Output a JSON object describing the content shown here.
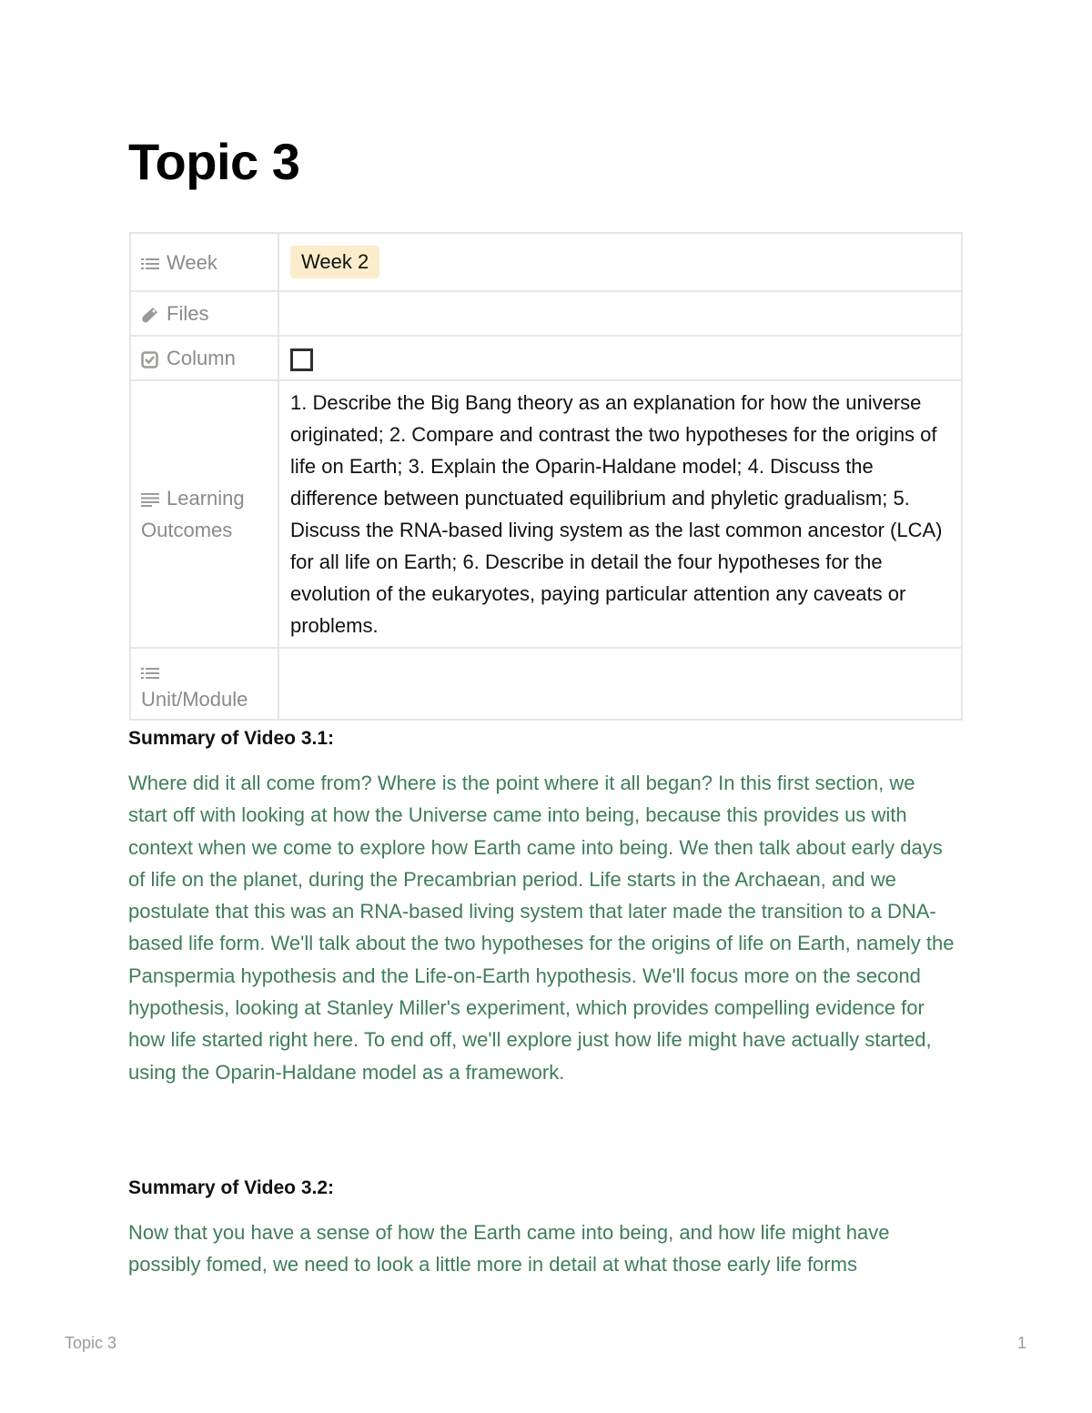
{
  "page": {
    "title": "Topic 3"
  },
  "properties": [
    {
      "icon": "list-icon",
      "name": "Week",
      "value": "Week 2",
      "type": "select",
      "badge_color": "#fbeccb"
    },
    {
      "icon": "paperclip-icon",
      "name": "Files",
      "value": "",
      "type": "files"
    },
    {
      "icon": "checkbox-icon",
      "name": "Column",
      "value": false,
      "type": "checkbox"
    },
    {
      "icon": "text-lines-icon",
      "name": "Learning Outcomes",
      "value": "1. Describe the Big Bang theory as an explanation for how the universe originated; 2. Compare and contrast the two hypotheses for the origins of life on Earth; 3. Explain the Oparin-Haldane model; 4. Discuss the difference between punctuated equilibrium and phyletic gradualism; 5. Discuss the RNA-based living system as the last common ancestor (LCA) for all life on Earth; 6. Describe in detail the four hypotheses for the evolution of the eukaryotes, paying particular attention any caveats or problems.",
      "type": "text"
    },
    {
      "icon": "list-icon",
      "name": "Unit/Module",
      "value": "",
      "type": "select"
    }
  ],
  "sections": [
    {
      "heading": "Summary of Video 3.1:",
      "body": "Where did it all come from? Where is the point where it all began? In this first section, we start off with looking at how the Universe came into being, because this provides us with context when we come to explore how Earth came into being. We then talk about early days of life on the planet, during the Precambrian period. Life starts in the Archaean, and we postulate that this was an RNA-based living system that later made the transition to a DNA-based life form. We'll talk about the two hypotheses for the origins of life on Earth, namely the Panspermia hypothesis and the Life-on-Earth hypothesis. We'll focus more on the second hypothesis, looking at Stanley Miller's experiment, which provides compelling evidence for how life started right here. To end off, we'll explore just how life might have actually started, using the Oparin-Haldane model as a framework."
    },
    {
      "heading": "Summary of Video 3.2:",
      "body": "Now that you have a sense of how the Earth came into being, and how life might have possibly fomed, we need to look a little more in detail at what those early life forms"
    }
  ],
  "colors": {
    "summary_text": "#3f7d5a",
    "property_label": "#8a8a87",
    "week_badge": "#fbeccb"
  },
  "footer": {
    "title": "Topic 3",
    "page_number": "1"
  }
}
